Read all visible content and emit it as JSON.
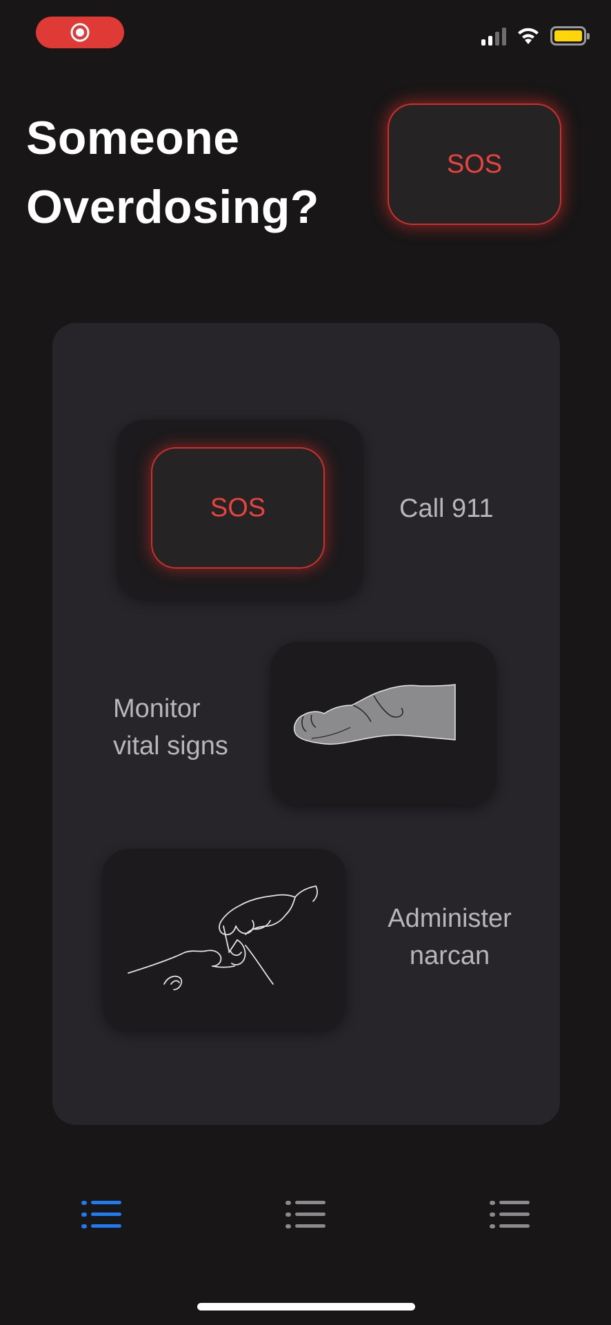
{
  "status_bar": {
    "record_icon": "record-icon",
    "signal_icon": "cellular-signal-icon",
    "wifi_icon": "wifi-icon",
    "battery_icon": "battery-icon",
    "battery_color": "#ffd60a",
    "record_color": "#e03a36"
  },
  "header": {
    "title_line1": "Someone",
    "title_line2": "Overdosing?",
    "sos_label": "SOS"
  },
  "steps": {
    "call": {
      "button_label": "SOS",
      "label": "Call 911"
    },
    "monitor": {
      "label_line1": "Monitor",
      "label_line2": "vital signs",
      "image_icon": "wrist-pulse-illustration"
    },
    "narcan": {
      "label_line1": "Administer",
      "label_line2": "narcan",
      "image_icon": "nasal-spray-illustration"
    }
  },
  "tabbar": {
    "tabs": [
      {
        "icon": "list-icon",
        "active": true
      },
      {
        "icon": "list-icon",
        "active": false
      },
      {
        "icon": "list-icon",
        "active": false
      }
    ],
    "active_color": "#1f7bf2",
    "inactive_color": "#8c8a8d"
  },
  "colors": {
    "sos_red": "#e8443f",
    "background": "#181617",
    "card": "#28252a"
  }
}
